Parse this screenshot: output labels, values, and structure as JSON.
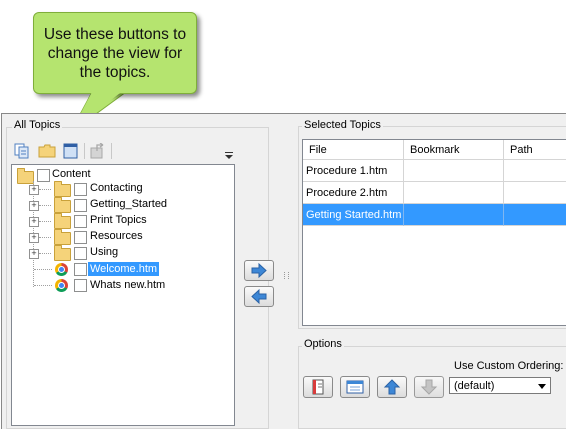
{
  "callout": {
    "lines": [
      "Use these buttons to",
      "change the view for",
      "the topics."
    ],
    "fill": "#b5e46f"
  },
  "all_topics": {
    "title": "All Topics",
    "toolbar": [
      "copy-pages-icon",
      "folder-icon",
      "list-view-icon",
      "disabled-export-icon"
    ],
    "tree": {
      "root": "Content",
      "folders": [
        "Contacting",
        "Getting_Started",
        "Print Topics",
        "Resources",
        "Using"
      ],
      "files": [
        {
          "name": "Welcome.htm",
          "selected": true
        },
        {
          "name": "Whats new.htm",
          "selected": false
        }
      ]
    }
  },
  "transfer": {
    "add_icon": "arrow-right-icon",
    "remove_icon": "arrow-left-icon",
    "accent": "#3d87d6"
  },
  "selected_topics": {
    "title": "Selected Topics",
    "columns": [
      "File",
      "Bookmark",
      "Path"
    ],
    "rows": [
      {
        "file": "Procedure 1.htm",
        "bookmark": "",
        "path": "",
        "selected": false
      },
      {
        "file": "Procedure 2.htm",
        "bookmark": "",
        "path": "",
        "selected": false
      },
      {
        "file": "Getting Started.htm",
        "bookmark": "",
        "path": "",
        "selected": true
      }
    ],
    "selection_color": "#3399ff"
  },
  "options": {
    "title": "Options",
    "buttons": [
      "book-icon",
      "window-icon",
      "move-up-icon",
      "move-down-icon"
    ],
    "ordering_label": "Use Custom Ordering:",
    "ordering_value": "(default)"
  }
}
